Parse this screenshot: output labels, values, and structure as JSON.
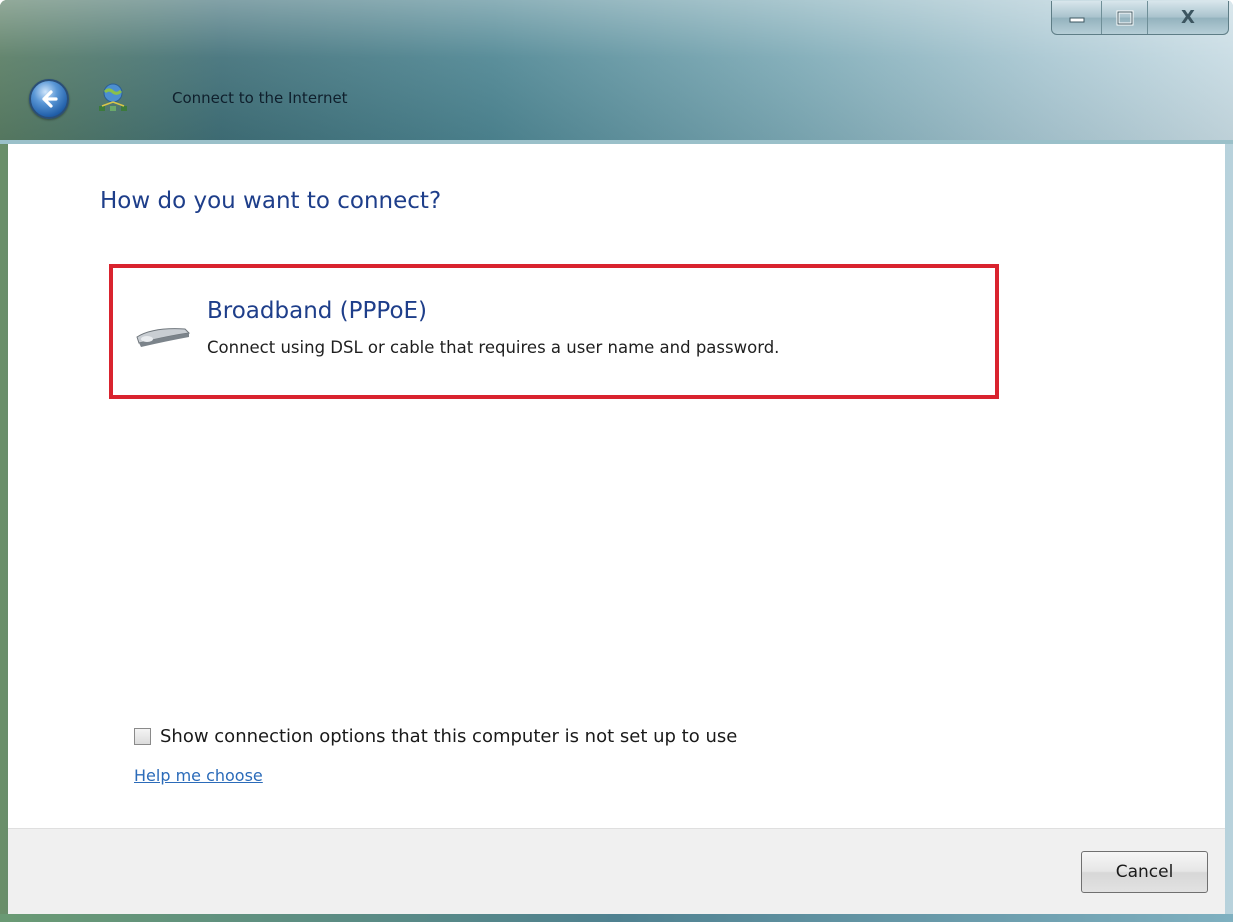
{
  "window": {
    "title": "Connect to the Internet",
    "caption_buttons": {
      "minimize": "minimize",
      "maximize": "maximize",
      "close": "X"
    }
  },
  "main": {
    "heading": "How do you want to connect?",
    "option": {
      "title": "Broadband (PPPoE)",
      "description": "Connect using DSL or cable that requires a user name and password.",
      "icon": "modem-icon",
      "highlight_color": "#d9232e"
    },
    "checkbox": {
      "label": "Show connection options that this computer is not set up to use",
      "checked": false
    },
    "help_link": "Help me choose"
  },
  "footer": {
    "cancel_label": "Cancel"
  },
  "colors": {
    "heading": "#1e3e8a",
    "link": "#2b6bb9"
  }
}
